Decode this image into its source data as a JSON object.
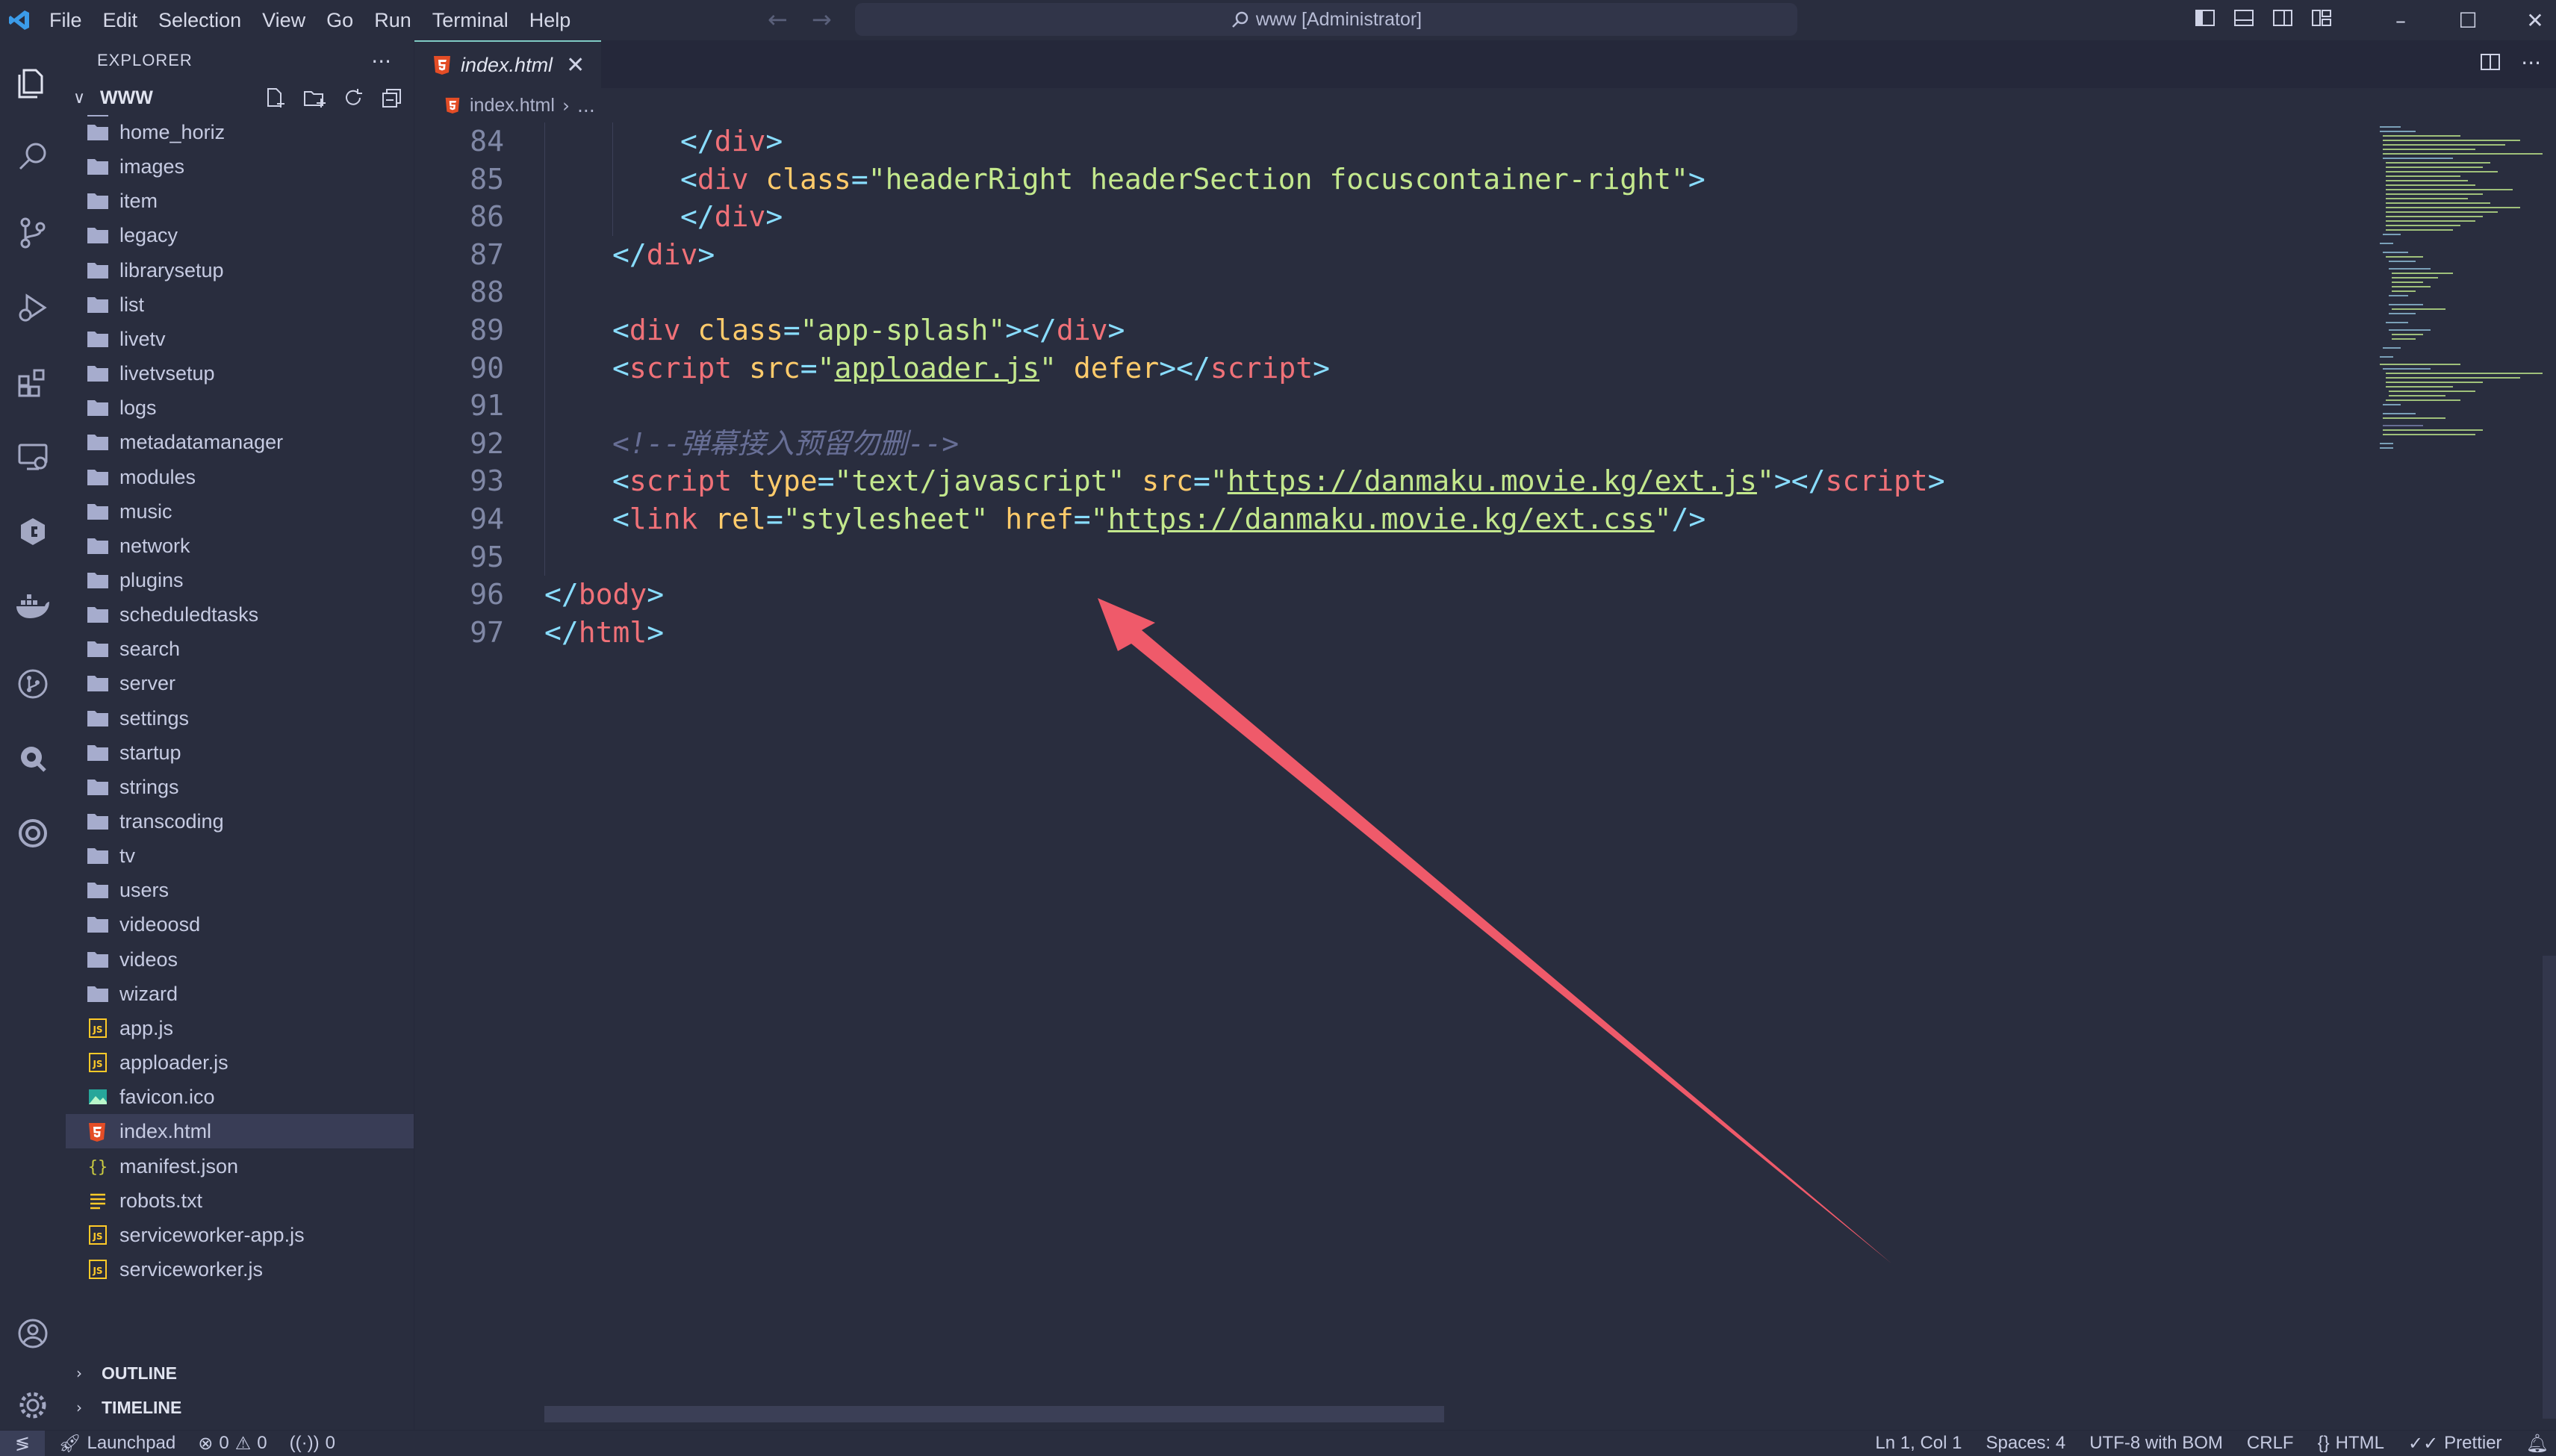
{
  "window": {
    "command_center": "www [Administrator]",
    "menu": [
      "File",
      "Edit",
      "Selection",
      "View",
      "Go",
      "Run",
      "Terminal",
      "Help"
    ]
  },
  "colors": {
    "background": "#292d3e",
    "tag": "#89ddff",
    "attribute": "#ffcb6b",
    "string": "#c3e88d",
    "comment": "#676e95",
    "annotation_arrow": "#ef5a6a"
  },
  "sidebar": {
    "title": "EXPLORER",
    "root_folder": "WWW",
    "items": [
      {
        "name": "home_horiz",
        "type": "folder"
      },
      {
        "name": "images",
        "type": "folder"
      },
      {
        "name": "item",
        "type": "folder"
      },
      {
        "name": "legacy",
        "type": "folder"
      },
      {
        "name": "librarysetup",
        "type": "folder"
      },
      {
        "name": "list",
        "type": "folder"
      },
      {
        "name": "livetv",
        "type": "folder"
      },
      {
        "name": "livetvsetup",
        "type": "folder"
      },
      {
        "name": "logs",
        "type": "folder"
      },
      {
        "name": "metadatamanager",
        "type": "folder"
      },
      {
        "name": "modules",
        "type": "folder"
      },
      {
        "name": "music",
        "type": "folder"
      },
      {
        "name": "network",
        "type": "folder"
      },
      {
        "name": "plugins",
        "type": "folder"
      },
      {
        "name": "scheduledtasks",
        "type": "folder"
      },
      {
        "name": "search",
        "type": "folder"
      },
      {
        "name": "server",
        "type": "folder"
      },
      {
        "name": "settings",
        "type": "folder"
      },
      {
        "name": "startup",
        "type": "folder"
      },
      {
        "name": "strings",
        "type": "folder"
      },
      {
        "name": "transcoding",
        "type": "folder"
      },
      {
        "name": "tv",
        "type": "folder"
      },
      {
        "name": "users",
        "type": "folder"
      },
      {
        "name": "videoosd",
        "type": "folder"
      },
      {
        "name": "videos",
        "type": "folder"
      },
      {
        "name": "wizard",
        "type": "folder"
      },
      {
        "name": "app.js",
        "type": "js"
      },
      {
        "name": "apploader.js",
        "type": "js"
      },
      {
        "name": "favicon.ico",
        "type": "image"
      },
      {
        "name": "index.html",
        "type": "html",
        "selected": true
      },
      {
        "name": "manifest.json",
        "type": "json"
      },
      {
        "name": "robots.txt",
        "type": "text"
      },
      {
        "name": "serviceworker-app.js",
        "type": "js"
      },
      {
        "name": "serviceworker.js",
        "type": "js"
      }
    ],
    "sections": [
      "OUTLINE",
      "TIMELINE"
    ]
  },
  "editor": {
    "tab": "index.html",
    "breadcrumb": [
      "index.html",
      "..."
    ],
    "lines": [
      {
        "n": "84",
        "indent": 2,
        "tokens": [
          [
            "t",
            "</"
          ],
          [
            "tg",
            "div"
          ],
          [
            "t",
            ">"
          ]
        ]
      },
      {
        "n": "85",
        "indent": 2,
        "tokens": [
          [
            "t",
            "<"
          ],
          [
            "tg",
            "div"
          ],
          [
            "pl",
            " "
          ],
          [
            "at",
            "class"
          ],
          [
            "t",
            "="
          ],
          [
            "st",
            "\"headerRight headerSection focuscontainer-right\""
          ],
          [
            "t",
            ">"
          ]
        ]
      },
      {
        "n": "86",
        "indent": 2,
        "tokens": [
          [
            "t",
            "</"
          ],
          [
            "tg",
            "div"
          ],
          [
            "t",
            ">"
          ]
        ]
      },
      {
        "n": "87",
        "indent": 1,
        "tokens": [
          [
            "t",
            "</"
          ],
          [
            "tg",
            "div"
          ],
          [
            "t",
            ">"
          ]
        ]
      },
      {
        "n": "88",
        "indent": 0,
        "tokens": []
      },
      {
        "n": "89",
        "indent": 1,
        "tokens": [
          [
            "t",
            "<"
          ],
          [
            "tg",
            "div"
          ],
          [
            "pl",
            " "
          ],
          [
            "at",
            "class"
          ],
          [
            "t",
            "="
          ],
          [
            "st",
            "\"app-splash\""
          ],
          [
            "t",
            "></"
          ],
          [
            "tg",
            "div"
          ],
          [
            "t",
            ">"
          ]
        ]
      },
      {
        "n": "90",
        "indent": 1,
        "tokens": [
          [
            "t",
            "<"
          ],
          [
            "tg",
            "script"
          ],
          [
            "pl",
            " "
          ],
          [
            "at",
            "src"
          ],
          [
            "t",
            "="
          ],
          [
            "st",
            "\""
          ],
          [
            "stu",
            "apploader.js"
          ],
          [
            "st",
            "\""
          ],
          [
            "pl",
            " "
          ],
          [
            "at",
            "defer"
          ],
          [
            "t",
            "></"
          ],
          [
            "tg",
            "script"
          ],
          [
            "t",
            ">"
          ]
        ]
      },
      {
        "n": "91",
        "indent": 0,
        "tokens": []
      },
      {
        "n": "92",
        "indent": 1,
        "tokens": [
          [
            "cm",
            "<!--弹幕接入预留勿删-->"
          ]
        ]
      },
      {
        "n": "93",
        "indent": 1,
        "tokens": [
          [
            "t",
            "<"
          ],
          [
            "tg",
            "script"
          ],
          [
            "pl",
            " "
          ],
          [
            "at",
            "type"
          ],
          [
            "t",
            "="
          ],
          [
            "st",
            "\"text/javascript\""
          ],
          [
            "pl",
            " "
          ],
          [
            "at",
            "src"
          ],
          [
            "t",
            "="
          ],
          [
            "st",
            "\""
          ],
          [
            "stu",
            "https://danmaku.movie.kg/ext.js"
          ],
          [
            "st",
            "\""
          ],
          [
            "t",
            "></"
          ],
          [
            "tg",
            "script"
          ],
          [
            "t",
            ">"
          ]
        ]
      },
      {
        "n": "94",
        "indent": 1,
        "tokens": [
          [
            "t",
            "<"
          ],
          [
            "tg",
            "link"
          ],
          [
            "pl",
            " "
          ],
          [
            "at",
            "rel"
          ],
          [
            "t",
            "="
          ],
          [
            "st",
            "\"stylesheet\""
          ],
          [
            "pl",
            " "
          ],
          [
            "at",
            "href"
          ],
          [
            "t",
            "="
          ],
          [
            "st",
            "\""
          ],
          [
            "stu",
            "https://danmaku.movie.kg/ext.css"
          ],
          [
            "st",
            "\""
          ],
          [
            "t",
            "/>"
          ]
        ]
      },
      {
        "n": "95",
        "indent": 0,
        "tokens": []
      },
      {
        "n": "96",
        "indent": 0,
        "tokens": [
          [
            "t",
            "</"
          ],
          [
            "tg",
            "body"
          ],
          [
            "t",
            ">"
          ]
        ]
      },
      {
        "n": "97",
        "indent": 0,
        "tokens": [
          [
            "t",
            "</"
          ],
          [
            "tg",
            "html"
          ],
          [
            "t",
            ">"
          ]
        ]
      }
    ]
  },
  "statusbar": {
    "launchpad": "Launchpad",
    "errors": "0",
    "warnings": "0",
    "ports": "0",
    "cursor": "Ln 1, Col 1",
    "spaces": "Spaces: 4",
    "encoding": "UTF-8 with BOM",
    "eol": "CRLF",
    "language": "HTML",
    "formatter": "Prettier"
  }
}
